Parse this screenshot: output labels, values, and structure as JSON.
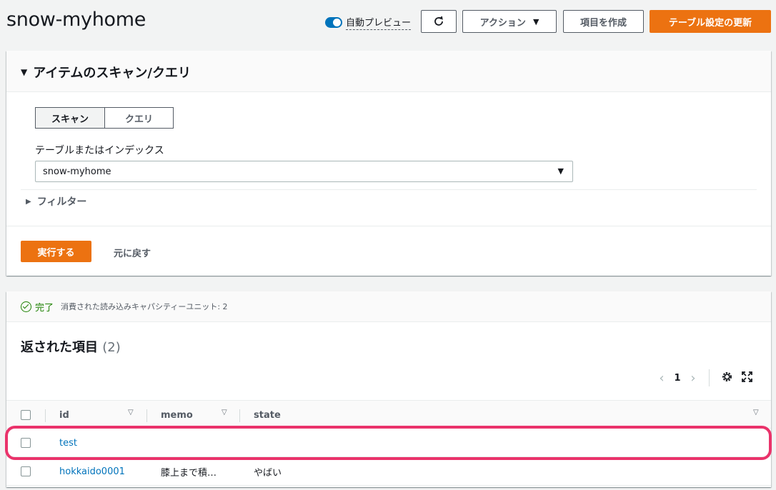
{
  "header": {
    "title": "snow-myhome",
    "preview_label": "自動プレビュー",
    "preview_on": true,
    "actions_label": "アクション",
    "create_label": "項目を作成",
    "update_label": "テーブル設定の更新"
  },
  "scan_panel": {
    "title": "アイテムのスキャン/クエリ",
    "tabs": [
      {
        "label": "スキャン",
        "active": true
      },
      {
        "label": "クエリ",
        "active": false
      }
    ],
    "table_label": "テーブルまたはインデックス",
    "table_value": "snow-myhome",
    "filter_label": "フィルター",
    "run_label": "実行する",
    "reset_label": "元に戻す"
  },
  "results": {
    "status": "完了",
    "status_detail": "消費された読み込みキャパシティーユニット: 2",
    "title": "返された項目",
    "count": "(2)",
    "page": "1",
    "columns": [
      "id",
      "memo",
      "state"
    ],
    "rows": [
      {
        "id": "test",
        "memo": "",
        "state": ""
      },
      {
        "id": "hokkaido0001",
        "memo": "膝上まで積…",
        "state": "やばい"
      }
    ]
  },
  "colors": {
    "primary": "#ec7211",
    "link": "#0073bb",
    "success": "#1d8102",
    "highlight": "#ea336b"
  }
}
